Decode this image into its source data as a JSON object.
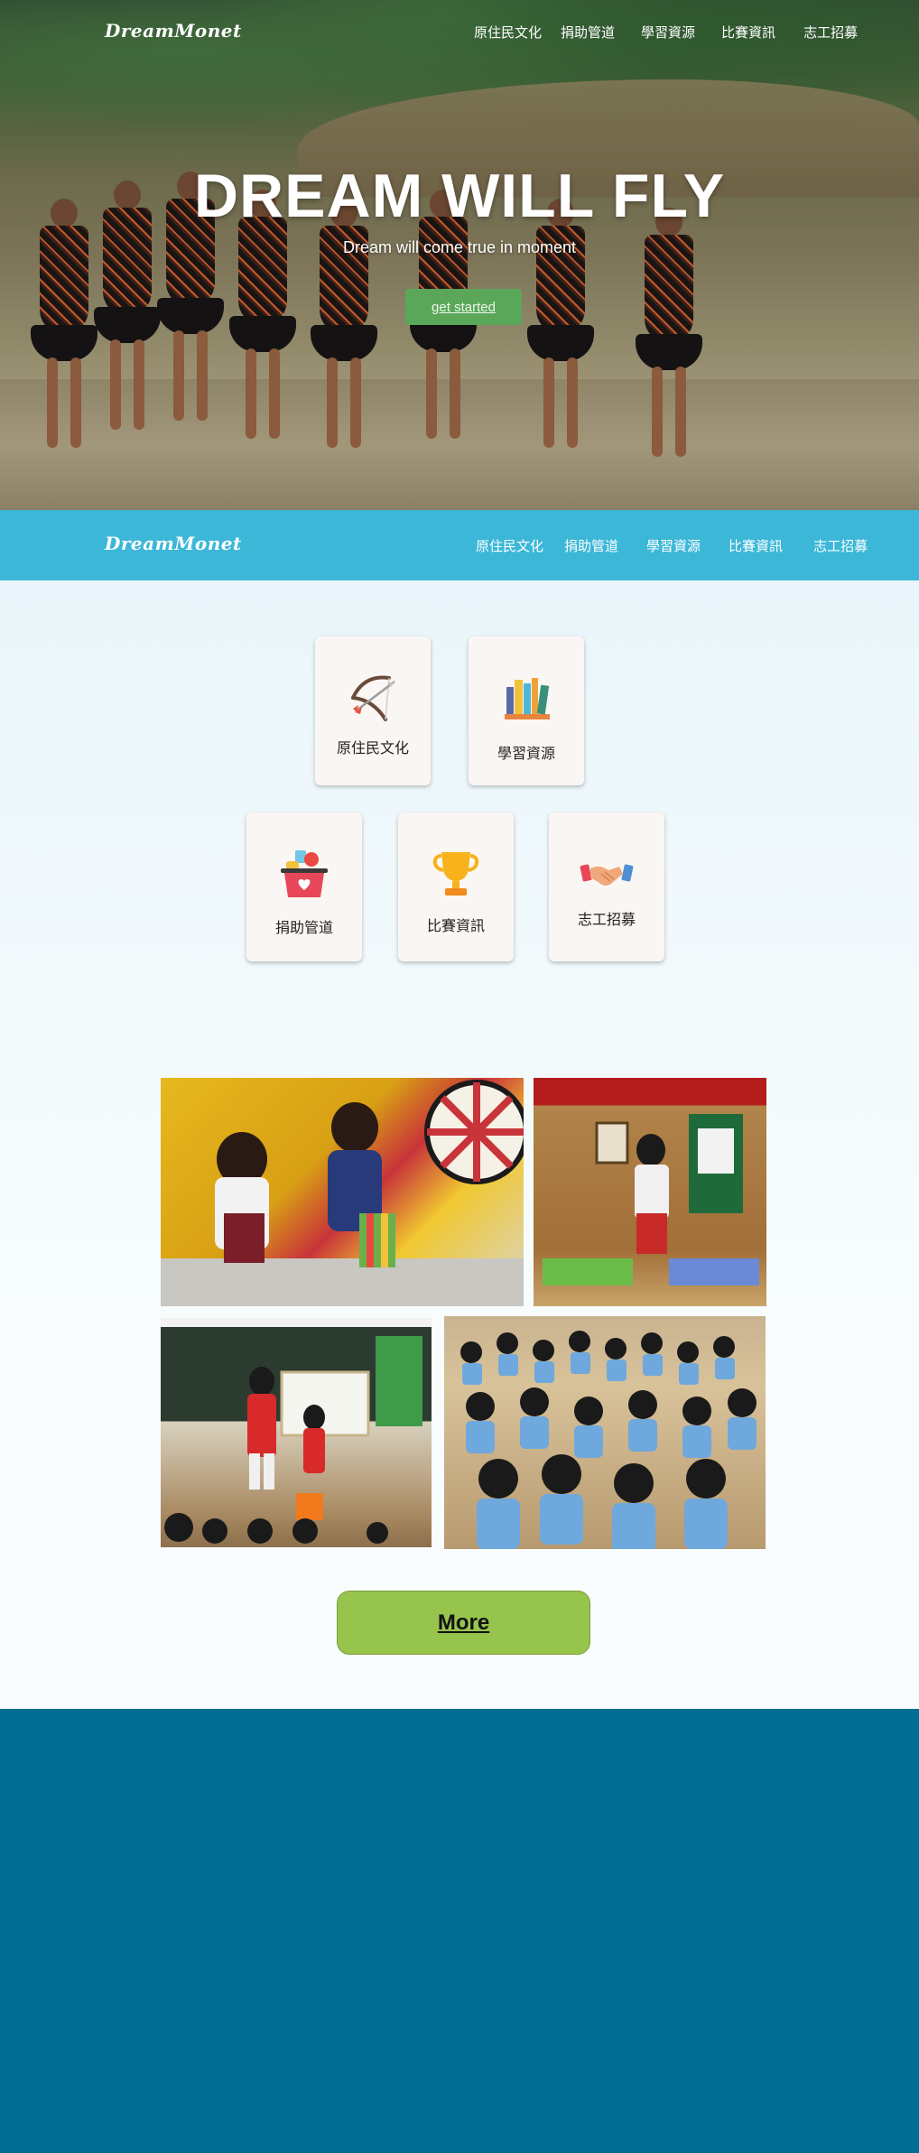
{
  "brand": {
    "logo_text": "DreamMonet"
  },
  "nav": {
    "items": [
      {
        "label": "原住民文化"
      },
      {
        "label": "捐助管道"
      },
      {
        "label": "學習資源"
      },
      {
        "label": "比賽資訊"
      },
      {
        "label": "志工招募"
      }
    ]
  },
  "hero": {
    "title": "DREAM WILL FLY",
    "subtitle": "Dream will come true in moment",
    "cta_label": "get started"
  },
  "categories": [
    {
      "label": "原住民文化",
      "icon": "bow-and-arrow-icon"
    },
    {
      "label": "學習資源",
      "icon": "books-icon"
    },
    {
      "label": "捐助管道",
      "icon": "donation-basket-icon"
    },
    {
      "label": "比賽資訊",
      "icon": "trophy-icon"
    },
    {
      "label": "志工招募",
      "icon": "handshake-icon"
    }
  ],
  "gallery": {
    "more_label": "More"
  },
  "colors": {
    "navbar": "#3cb7d8",
    "cta": "#5aa75a",
    "more_button": "#97c44d",
    "footer": "#006e93"
  }
}
